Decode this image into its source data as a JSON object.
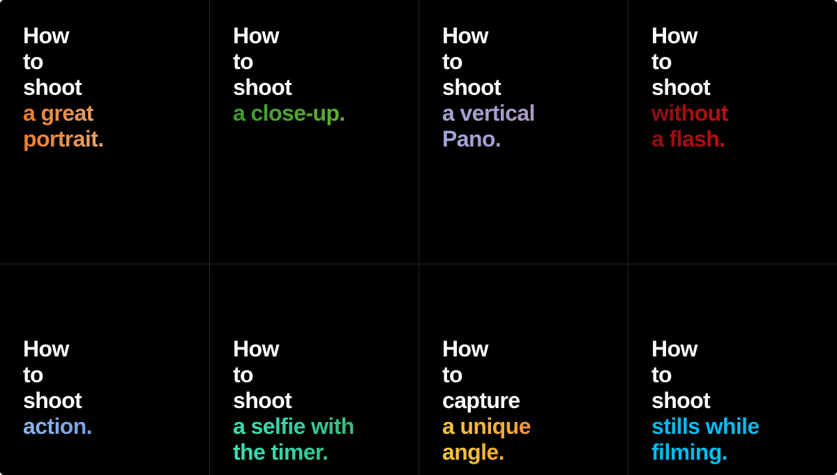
{
  "page": {
    "title": "How to shoot — tip grid",
    "background_color": "#000000",
    "divider_color": "#2a2a2a",
    "plain_text_color": "#ffffff"
  },
  "grid": {
    "columns": 4,
    "rows": 2
  },
  "cards": [
    {
      "id": "great-portrait",
      "accent_name": "orange",
      "accent_colors": [
        "#ef7c26",
        "#9b9287"
      ],
      "plain_lines": [
        "How",
        "to",
        "shoot"
      ],
      "accent_lines": [
        "a great",
        "portrait."
      ]
    },
    {
      "id": "close-up",
      "accent_name": "green",
      "accent_colors": [
        "#3c9a34",
        "#74bb2f"
      ],
      "plain_lines": [
        "How",
        "to",
        "shoot"
      ],
      "accent_lines": [
        "a close-up."
      ]
    },
    {
      "id": "vertical-pano",
      "accent_name": "purple",
      "accent_colors": [
        "#9fa8dd",
        "#c489a4"
      ],
      "plain_lines": [
        "How",
        "to",
        "shoot"
      ],
      "accent_lines": [
        "a vertical",
        "Pano."
      ]
    },
    {
      "id": "without-a-flash",
      "accent_name": "red",
      "accent_colors": [
        "#8c0d10",
        "#e4121a"
      ],
      "plain_lines": [
        "How",
        "to",
        "shoot"
      ],
      "accent_lines": [
        "without",
        "a flash."
      ]
    },
    {
      "id": "action",
      "accent_name": "blue",
      "accent_colors": [
        "#8fb5ea",
        "#3d74d0"
      ],
      "plain_lines": [
        "How",
        "to",
        "shoot"
      ],
      "accent_lines": [
        "action."
      ]
    },
    {
      "id": "selfie-with-timer",
      "accent_name": "teal",
      "accent_colors": [
        "#3ee0b8",
        "#3f9a57"
      ],
      "plain_lines": [
        "How",
        "to",
        "shoot"
      ],
      "accent_lines": [
        "a selfie with",
        "the timer."
      ]
    },
    {
      "id": "unique-angle",
      "accent_name": "amber",
      "accent_colors": [
        "#f7c93c",
        "#ef3f4e"
      ],
      "plain_lines": [
        "How",
        "to",
        "capture"
      ],
      "accent_lines": [
        "a unique",
        "angle."
      ]
    },
    {
      "id": "stills-while-filming",
      "accent_name": "cyan",
      "accent_colors": [
        "#00b8f0",
        "#6aa6b6"
      ],
      "plain_lines": [
        "How",
        "to",
        "shoot"
      ],
      "accent_lines": [
        "stills while",
        "filming."
      ]
    }
  ]
}
